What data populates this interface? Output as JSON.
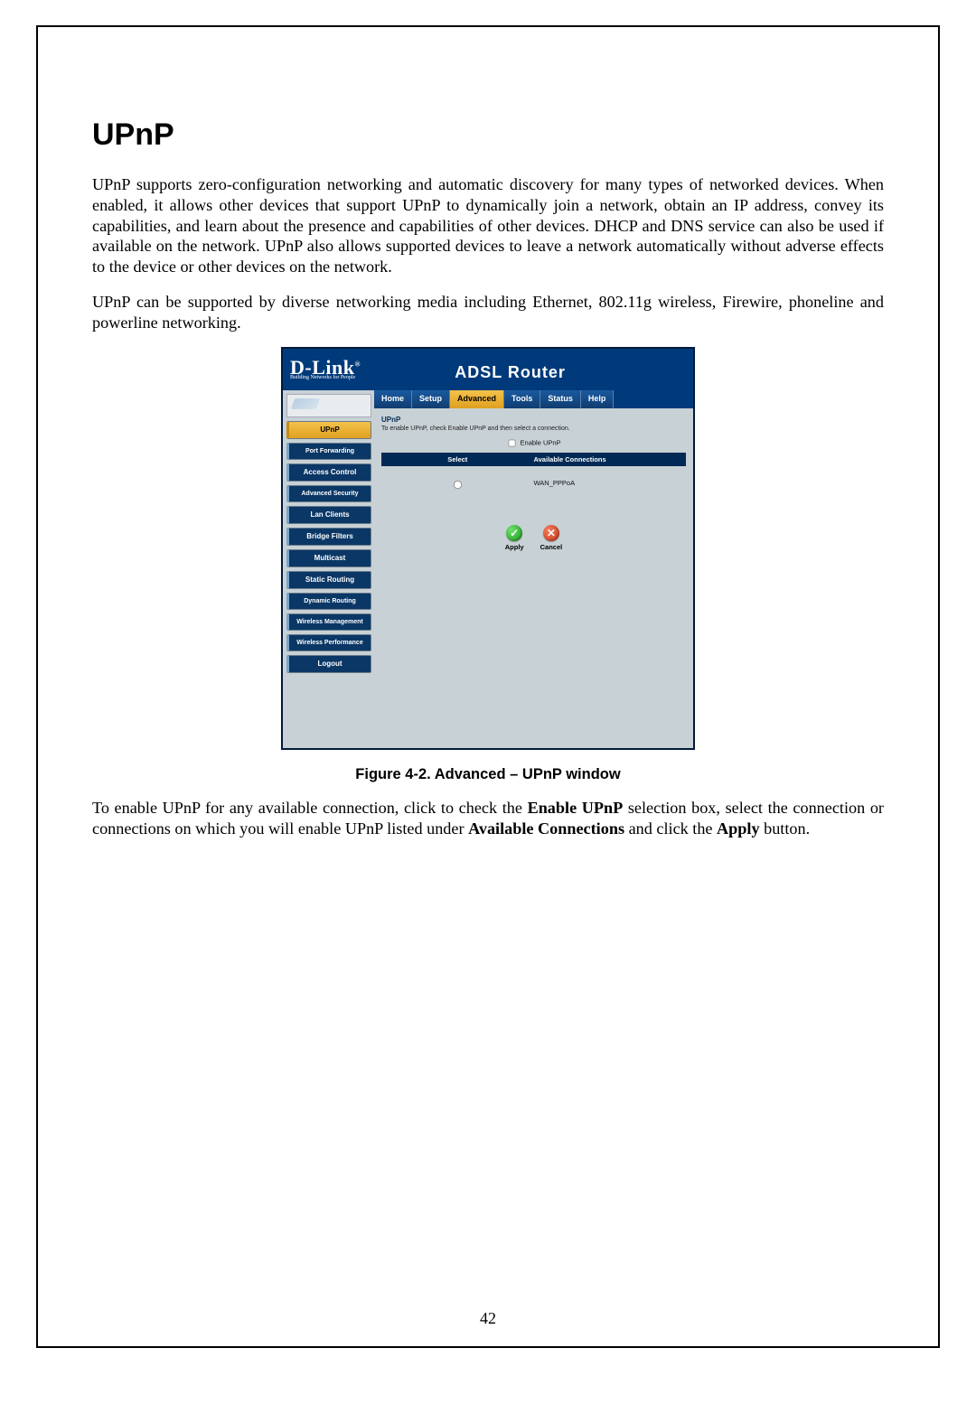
{
  "doc": {
    "section_title": "UPnP",
    "para1": "UPnP supports zero-configuration networking and automatic discovery for many types of networked devices. When enabled, it allows other devices that support UPnP to dynamically join a network, obtain an IP address, convey its capabilities, and learn about the presence and capabilities of other devices. DHCP and DNS service can also be used if available on the network. UPnP also allows supported devices to leave a network automatically without adverse effects to the device or other devices on the network.",
    "para2": "UPnP can be supported by diverse networking media including Ethernet, 802.11g wireless, Firewire, phoneline and powerline networking.",
    "figure_caption": "Figure 4-2. Advanced – UPnP window",
    "para3_pre": "To enable UPnP for any available connection, click to check the ",
    "para3_b1": "Enable UPnP",
    "para3_mid1": " selection box, select the connection or connections on which you will enable UPnP listed under ",
    "para3_b2": "Available Connections",
    "para3_mid2": " and click the ",
    "para3_b3": "Apply",
    "para3_end": " button.",
    "page_number": "42"
  },
  "router": {
    "logo_text": "D-Link",
    "logo_tag": "Building Networks for People",
    "title": "ADSL Router",
    "tabs": [
      "Home",
      "Setup",
      "Advanced",
      "Tools",
      "Status",
      "Help"
    ],
    "active_tab_index": 2,
    "sidebar": [
      {
        "label": "UPnP",
        "active": true
      },
      {
        "label": "Port Forwarding",
        "active": false
      },
      {
        "label": "Access Control",
        "active": false
      },
      {
        "label": "Advanced Security",
        "active": false
      },
      {
        "label": "Lan Clients",
        "active": false
      },
      {
        "label": "Bridge Filters",
        "active": false
      },
      {
        "label": "Multicast",
        "active": false
      },
      {
        "label": "Static Routing",
        "active": false
      },
      {
        "label": "Dynamic Routing",
        "active": false
      },
      {
        "label": "Wireless Management",
        "active": false
      },
      {
        "label": "Wireless Performance",
        "active": false
      },
      {
        "label": "Logout",
        "active": false
      }
    ],
    "content": {
      "heading": "UPnP",
      "desc": "To enable UPnP, check Enable UPnP and then select a connection.",
      "enable_label": "Enable UPnP",
      "table_headers": {
        "select": "Select",
        "connections": "Available Connections"
      },
      "rows": [
        {
          "connection": "WAN_PPPoA"
        }
      ],
      "apply_label": "Apply",
      "cancel_label": "Cancel"
    }
  }
}
